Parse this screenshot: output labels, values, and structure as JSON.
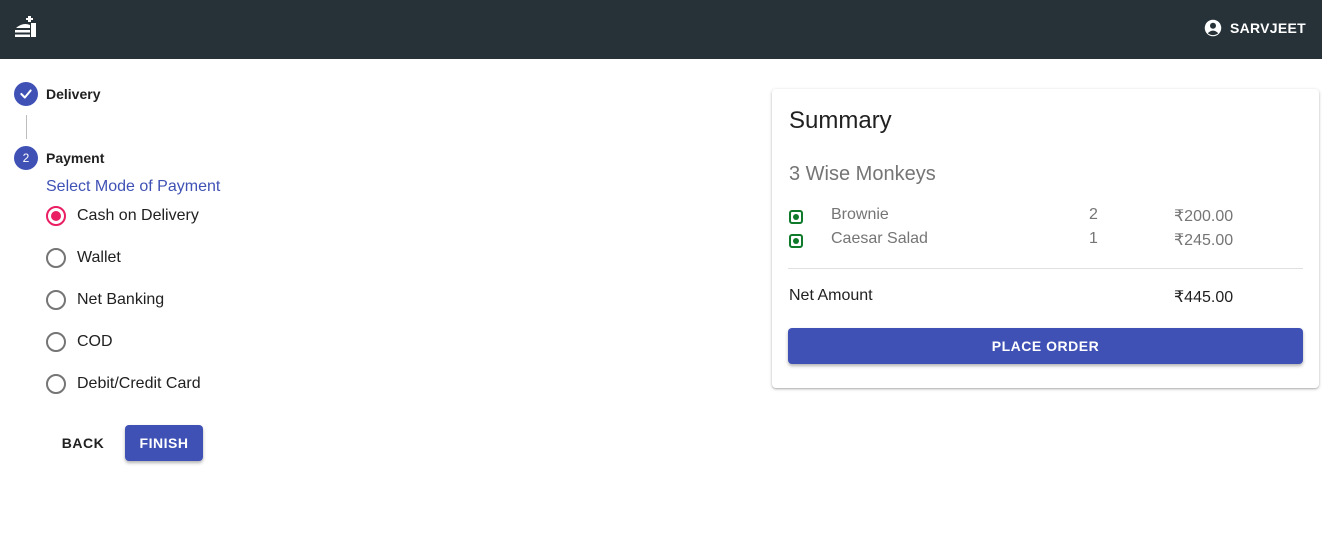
{
  "header": {
    "logo_icon": "restaurant-cloche-icon",
    "user_icon": "account-circle-icon",
    "username": "SARVJEET"
  },
  "stepper": {
    "steps": [
      {
        "label": "Delivery",
        "status": "completed",
        "icon": "check-icon"
      },
      {
        "label": "Payment",
        "number": "2",
        "status": "active"
      }
    ]
  },
  "payment": {
    "title": "Select Mode of Payment",
    "options": [
      {
        "label": "Cash on Delivery",
        "checked": true
      },
      {
        "label": "Wallet",
        "checked": false
      },
      {
        "label": "Net Banking",
        "checked": false
      },
      {
        "label": "COD",
        "checked": false
      },
      {
        "label": "Debit/Credit Card",
        "checked": false
      }
    ],
    "back_label": "BACK",
    "finish_label": "FINISH"
  },
  "summary": {
    "title": "Summary",
    "restaurant": "3 Wise Monkeys",
    "items": [
      {
        "name": "Brownie",
        "qty": "2",
        "price": "₹200.00"
      },
      {
        "name": "Caesar Salad",
        "qty": "1",
        "price": "₹245.00"
      }
    ],
    "net_label": "Net Amount",
    "net_value": "₹445.00",
    "place_order_label": "PLACE ORDER"
  },
  "colors": {
    "appbar": "#263238",
    "primary": "#3f51b5",
    "radio_selected": "#e91e63",
    "veg_indicator": "#0f7a2a"
  }
}
